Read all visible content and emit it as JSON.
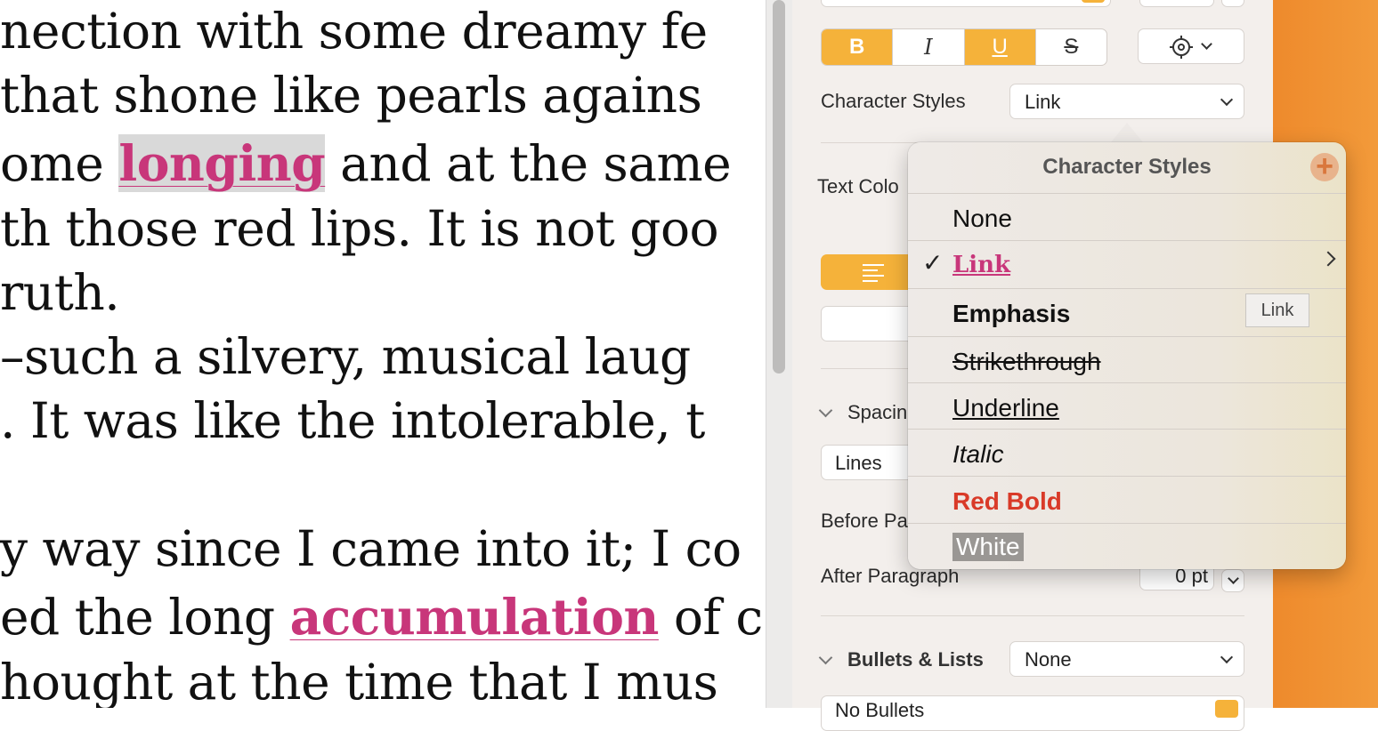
{
  "document": {
    "lines": [
      {
        "pre": "nection with some dreamy fe",
        "word": "",
        "post": ""
      },
      {
        "pre": "that shone like pearls agains",
        "word": "",
        "post": ""
      },
      {
        "pre": "ome ",
        "word": "longing",
        "post": " and at the same"
      },
      {
        "pre": "th those red lips. It is not goo",
        "word": "",
        "post": ""
      },
      {
        "pre": "ruth.",
        "word": "",
        "post": ""
      },
      {
        "pre": "–such a silvery, musical laug",
        "word": "",
        "post": ""
      },
      {
        "pre": ". It was like the intolerable, t",
        "word": "",
        "post": ""
      },
      {
        "pre": "",
        "word": "",
        "post": ""
      },
      {
        "pre": "y way since I came into it; I co",
        "word": "",
        "post": ""
      },
      {
        "pre": "ed the long ",
        "word": "accumulation",
        "post": " of c"
      },
      {
        "pre": "hought at the time that I mus",
        "word": "",
        "post": ""
      }
    ]
  },
  "inspector": {
    "style_buttons": {
      "bold": "B",
      "italic": "I",
      "underline": "U",
      "strike": "S"
    },
    "gear_icon": "gear-icon",
    "character_styles_label": "Character Styles",
    "character_styles_value": "Link",
    "text_color_label": "Text Colo",
    "spacing_label": "Spacin",
    "lines_value": "Lines",
    "before_paragraph_label": "Before Pa",
    "after_paragraph_label": "After Paragraph",
    "after_paragraph_value": "0 pt",
    "bullets_label": "Bullets & Lists",
    "bullets_value": "None",
    "no_bullets_value": "No Bullets"
  },
  "popover": {
    "title": "Character Styles",
    "items": [
      {
        "label": "None",
        "checked": false
      },
      {
        "label": "Link",
        "checked": true
      },
      {
        "label": "Emphasis",
        "checked": false
      },
      {
        "label": "Strikethrough",
        "checked": false
      },
      {
        "label": "Underline",
        "checked": false
      },
      {
        "label": "Italic",
        "checked": false
      },
      {
        "label": "Red Bold",
        "checked": false
      },
      {
        "label": "White",
        "checked": false
      }
    ],
    "tooltip": "Link"
  },
  "colors": {
    "accent": "#f5b23a",
    "link": "#c8367a",
    "red_bold": "#d93a28",
    "window_orange": "#f0932f"
  }
}
